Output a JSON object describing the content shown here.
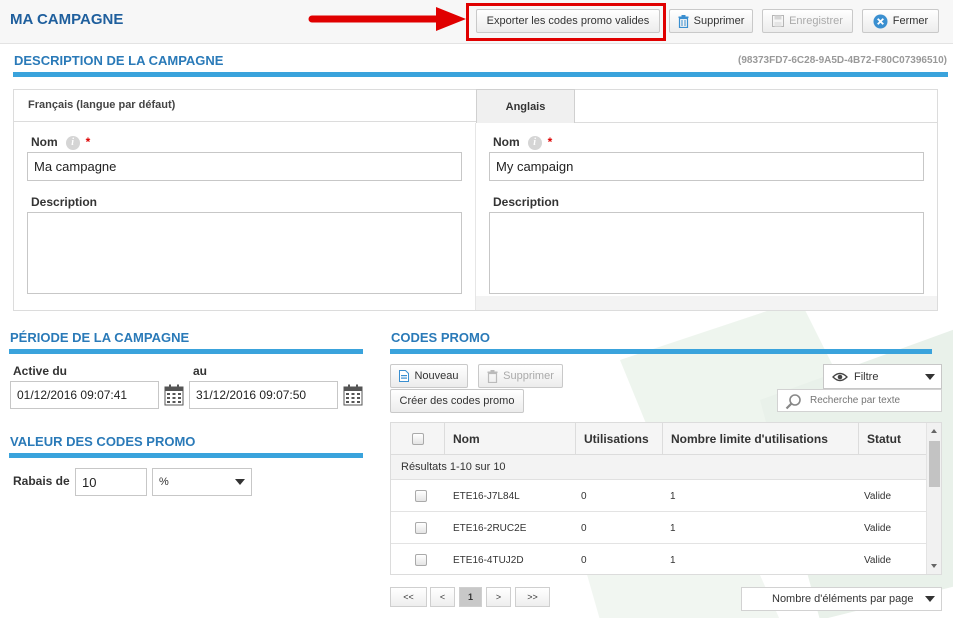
{
  "header": {
    "title": "MA CAMPAGNE",
    "buttons": {
      "export": "Exporter les codes promo valides",
      "delete": "Supprimer",
      "save": "Enregistrer",
      "close": "Fermer"
    }
  },
  "description": {
    "title": "DESCRIPTION DE LA CAMPAGNE",
    "guid": "(98373FD7-6C28-9A5D-4B72-F80C07396510)",
    "tabs": [
      "Français (langue par défaut)",
      "Anglais"
    ],
    "french": {
      "name_label": "Nom",
      "required_mark": "*",
      "name_value": "Ma campagne",
      "description_label": "Description",
      "description_value": ""
    },
    "english": {
      "name_label": "Nom",
      "required_mark": "*",
      "name_value": "My campaign",
      "description_label": "Description",
      "description_value": ""
    },
    "info_glyph": "i"
  },
  "period": {
    "title": "PÉRIODE DE LA CAMPAGNE",
    "start_label": "Active du",
    "start_value": "01/12/2016 09:07:41",
    "end_label": "au",
    "end_value": "31/12/2016 09:07:50"
  },
  "value": {
    "title": "VALEUR DES CODES PROMO",
    "discount_label": "Rabais de",
    "discount_value": "10",
    "unit_selected": "%"
  },
  "promo": {
    "title": "CODES PROMO",
    "buttons": {
      "new": "Nouveau",
      "delete": "Supprimer",
      "create": "Créer des codes promo",
      "filter": "Filtre"
    },
    "search_placeholder": "Recherche par texte",
    "columns": [
      "Nom",
      "Utilisations",
      "Nombre limite d'utilisations",
      "Statut"
    ],
    "results_text": "Résultats 1-10 sur 10",
    "rows": [
      {
        "name": "ETE16-J7L84L",
        "uses": "0",
        "limit": "1",
        "status": "Valide"
      },
      {
        "name": "ETE16-2RUC2E",
        "uses": "0",
        "limit": "1",
        "status": "Valide"
      },
      {
        "name": "ETE16-4TUJ2D",
        "uses": "0",
        "limit": "1",
        "status": "Valide"
      }
    ],
    "pager": {
      "first": "<<",
      "prev": "<",
      "current": "1",
      "next": ">",
      "last": ">>"
    },
    "page_size_label": "Nombre d'éléments par page"
  },
  "colors": {
    "title_blue": "#1f5f9d",
    "section_blue": "#2a7ab8",
    "section_bar": "#3aa3dc",
    "highlight_red": "#e00000"
  },
  "icons": {
    "delete": "trash-icon",
    "save": "save-icon",
    "close": "close-circle-icon",
    "new": "new-document-icon",
    "filter": "eye-icon",
    "search": "magnifier-icon",
    "calendar": "calendar-icon"
  }
}
